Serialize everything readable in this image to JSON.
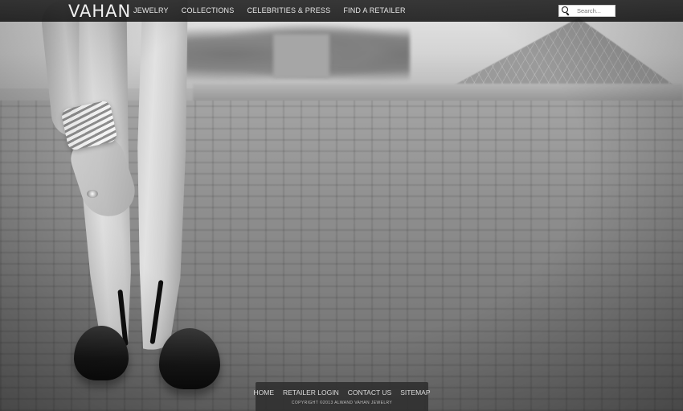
{
  "brand": {
    "logo": "VAHAN"
  },
  "nav": {
    "items": [
      {
        "label": "JEWELRY"
      },
      {
        "label": "COLLECTIONS"
      },
      {
        "label": "CELEBRITIES & PRESS"
      },
      {
        "label": "FIND A RETAILER"
      }
    ]
  },
  "search": {
    "placeholder": "Search...",
    "icon": "search-icon"
  },
  "footer": {
    "links": [
      {
        "label": "HOME"
      },
      {
        "label": "RETAILER LOGIN"
      },
      {
        "label": "CONTACT US"
      },
      {
        "label": "SITEMAP"
      }
    ],
    "copyright": "COPYRIGHT ©2013 ALWAND VAHAN JEWELRY"
  },
  "colors": {
    "header_bg": "#1e1e1e",
    "nav_text": "#e8e8e8",
    "footer_bg": "#2d2d2d"
  }
}
